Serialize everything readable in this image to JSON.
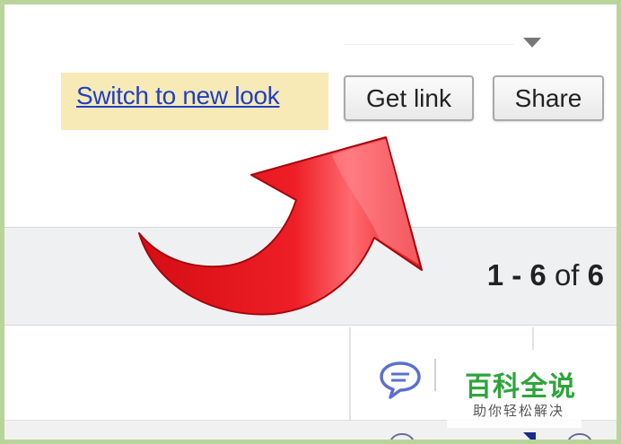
{
  "toolbar": {
    "switch_look_label": "Switch to new look",
    "get_link_label": "Get link",
    "share_label": "Share"
  },
  "list": {
    "pagination_range": "1 - 6",
    "pagination_of": "of",
    "pagination_total": "6"
  },
  "watermark": {
    "title": "百科全说",
    "subtitle": "助你轻松解决"
  },
  "icons": {
    "dropdown": "chevron-down-icon",
    "comment": "comment-icon",
    "annotation_arrow": "arrow-icon"
  },
  "colors": {
    "highlight_bg": "#f8eab6",
    "link": "#1f3fc7",
    "arrow_red": "#e3121b",
    "watermark_green": "#2fa43b",
    "page_border": "#b9d49a"
  }
}
